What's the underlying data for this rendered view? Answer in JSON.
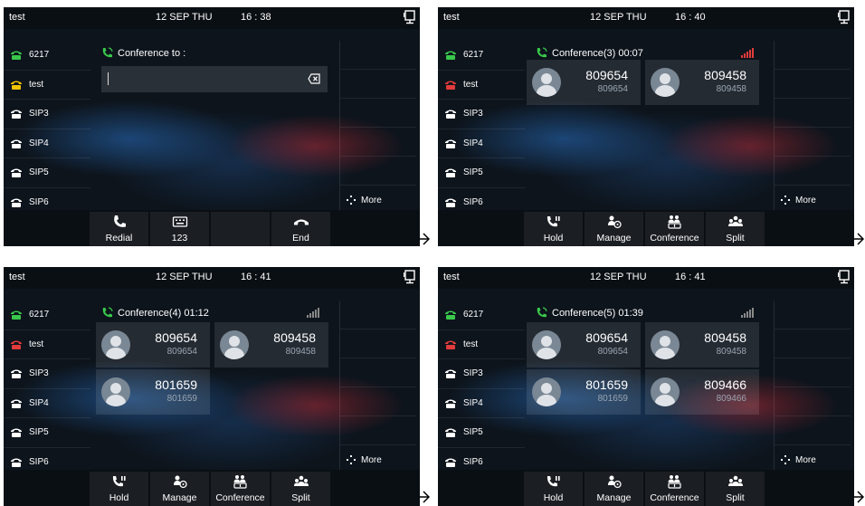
{
  "colors": {
    "green": "#39c84b",
    "yellow": "#f2c400",
    "red": "#e23b3b",
    "white": "#ffffff",
    "signal_red": "#e23b3b",
    "signal_gray": "#888888"
  },
  "screens": [
    {
      "topbar": {
        "account": "test",
        "date": "12 SEP THU",
        "time": "16 : 38"
      },
      "lines": [
        {
          "label": "6217",
          "icon": "phone-green"
        },
        {
          "label": "test",
          "icon": "phone-yellow"
        },
        {
          "label": "SIP3",
          "icon": "phone-white"
        },
        {
          "label": "SIP4",
          "icon": "phone-white"
        },
        {
          "label": "SIP5",
          "icon": "phone-white"
        },
        {
          "label": "SIP6",
          "icon": "phone-white"
        }
      ],
      "title": "Conference to :",
      "input_value": "",
      "more": "More",
      "softkeys": [
        {
          "label": "Redial",
          "icon": "handset-icon"
        },
        {
          "label": "123",
          "icon": "keyboard-icon"
        },
        {
          "label": "",
          "icon": ""
        },
        {
          "label": "End",
          "icon": "hangup-icon"
        }
      ]
    },
    {
      "topbar": {
        "account": "test",
        "date": "12 SEP THU",
        "time": "16 : 40"
      },
      "lines": [
        {
          "label": "6217",
          "icon": "phone-green"
        },
        {
          "label": "test",
          "icon": "phone-red"
        },
        {
          "label": "SIP3",
          "icon": "phone-white"
        },
        {
          "label": "SIP4",
          "icon": "phone-white"
        },
        {
          "label": "SIP5",
          "icon": "phone-white"
        },
        {
          "label": "SIP6",
          "icon": "phone-white"
        }
      ],
      "title": "Conference(3)  00:07",
      "signal": "red",
      "participants": [
        {
          "name": "809654",
          "number": "809654"
        },
        {
          "name": "809458",
          "number": "809458"
        }
      ],
      "more": "More",
      "softkeys": [
        {
          "label": "Hold",
          "icon": "hold-icon"
        },
        {
          "label": "Manage",
          "icon": "manage-icon"
        },
        {
          "label": "Conference",
          "icon": "conference-icon"
        },
        {
          "label": "Split",
          "icon": "split-icon"
        }
      ]
    },
    {
      "topbar": {
        "account": "test",
        "date": "12 SEP THU",
        "time": "16 : 41"
      },
      "lines": [
        {
          "label": "6217",
          "icon": "phone-green"
        },
        {
          "label": "test",
          "icon": "phone-red"
        },
        {
          "label": "SIP3",
          "icon": "phone-white"
        },
        {
          "label": "SIP4",
          "icon": "phone-white"
        },
        {
          "label": "SIP5",
          "icon": "phone-white"
        },
        {
          "label": "SIP6",
          "icon": "phone-white"
        }
      ],
      "title": "Conference(4)  01:12",
      "signal": "gray",
      "participants": [
        {
          "name": "809654",
          "number": "809654"
        },
        {
          "name": "809458",
          "number": "809458"
        },
        {
          "name": "801659",
          "number": "801659"
        }
      ],
      "more": "More",
      "softkeys": [
        {
          "label": "Hold",
          "icon": "hold-icon"
        },
        {
          "label": "Manage",
          "icon": "manage-icon"
        },
        {
          "label": "Conference",
          "icon": "conference-icon"
        },
        {
          "label": "Split",
          "icon": "split-icon"
        }
      ]
    },
    {
      "topbar": {
        "account": "test",
        "date": "12 SEP THU",
        "time": "16 : 41"
      },
      "lines": [
        {
          "label": "6217",
          "icon": "phone-green"
        },
        {
          "label": "test",
          "icon": "phone-red"
        },
        {
          "label": "SIP3",
          "icon": "phone-white"
        },
        {
          "label": "SIP4",
          "icon": "phone-white"
        },
        {
          "label": "SIP5",
          "icon": "phone-white"
        },
        {
          "label": "SIP6",
          "icon": "phone-white"
        }
      ],
      "title": "Conference(5)  01:39",
      "signal": "gray",
      "participants": [
        {
          "name": "809654",
          "number": "809654"
        },
        {
          "name": "809458",
          "number": "809458"
        },
        {
          "name": "801659",
          "number": "801659"
        },
        {
          "name": "809466",
          "number": "809466"
        }
      ],
      "more": "More",
      "softkeys": [
        {
          "label": "Hold",
          "icon": "hold-icon"
        },
        {
          "label": "Manage",
          "icon": "manage-icon"
        },
        {
          "label": "Conference",
          "icon": "conference-icon"
        },
        {
          "label": "Split",
          "icon": "split-icon"
        }
      ]
    }
  ]
}
